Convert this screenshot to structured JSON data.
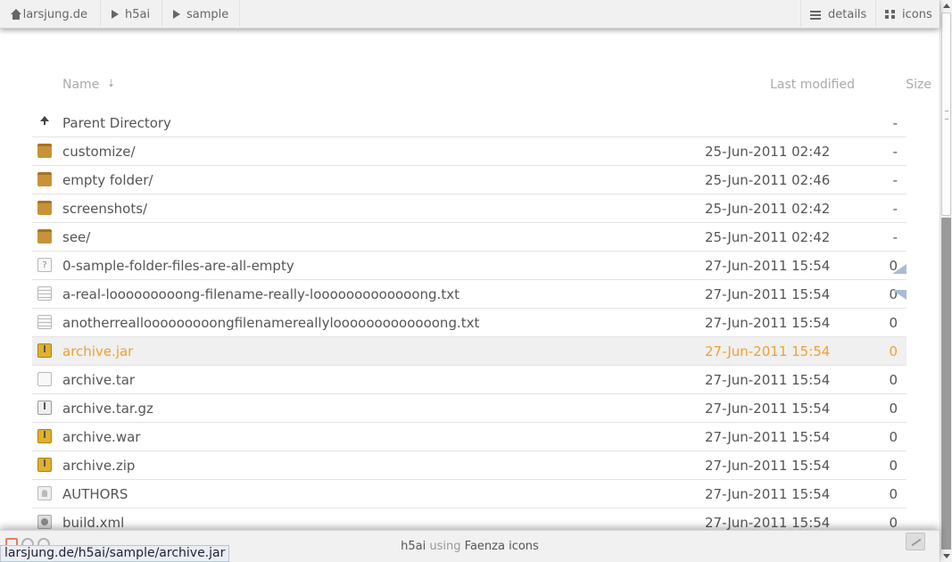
{
  "breadcrumbs": [
    "larsjung.de",
    "h5ai",
    "sample"
  ],
  "views": {
    "details_label": "details",
    "icons_label": "icons"
  },
  "columns": {
    "name": "Name",
    "sort_indicator": "⇣",
    "last_modified": "Last modified",
    "size": "Size"
  },
  "rows": [
    {
      "icon": "up-arrow-icon",
      "name": "Parent Directory",
      "date": "",
      "size": "-"
    },
    {
      "icon": "folder-icon",
      "name": "customize/",
      "date": "25-Jun-2011 02:42",
      "size": "-"
    },
    {
      "icon": "folder-icon",
      "name": "empty folder/",
      "date": "25-Jun-2011 02:46",
      "size": "-"
    },
    {
      "icon": "folder-icon",
      "name": "screenshots/",
      "date": "25-Jun-2011 02:42",
      "size": "-"
    },
    {
      "icon": "folder-icon",
      "name": "see/",
      "date": "25-Jun-2011 02:42",
      "size": "-"
    },
    {
      "icon": "unknown-file-icon",
      "name": "0-sample-folder-files-are-all-empty",
      "date": "27-Jun-2011 15:54",
      "size": "0"
    },
    {
      "icon": "text-file-icon",
      "name": "a-real-looooooooong-filename-really-looooooooooooong.txt",
      "date": "27-Jun-2011 15:54",
      "size": "0"
    },
    {
      "icon": "text-file-icon",
      "name": "anotherreallooooooooongfilenamereallylooooooooooooong.txt",
      "date": "27-Jun-2011 15:54",
      "size": "0"
    },
    {
      "icon": "archive-icon",
      "name": "archive.jar",
      "date": "27-Jun-2011 15:54",
      "size": "0",
      "highlighted": true
    },
    {
      "icon": "blank-file-icon",
      "name": "archive.tar",
      "date": "27-Jun-2011 15:54",
      "size": "0"
    },
    {
      "icon": "archive-grey-icon",
      "name": "archive.tar.gz",
      "date": "27-Jun-2011 15:54",
      "size": "0"
    },
    {
      "icon": "archive-icon",
      "name": "archive.war",
      "date": "27-Jun-2011 15:54",
      "size": "0"
    },
    {
      "icon": "archive-icon",
      "name": "archive.zip",
      "date": "27-Jun-2011 15:54",
      "size": "0"
    },
    {
      "icon": "person-file-icon",
      "name": "AUTHORS",
      "date": "27-Jun-2011 15:54",
      "size": "0"
    },
    {
      "icon": "gear-file-icon",
      "name": "build.xml",
      "date": "27-Jun-2011 15:54",
      "size": "0"
    }
  ],
  "footer": {
    "app": "h5ai",
    "using": "using",
    "icons": "Faenza icons"
  },
  "status_url": "larsjung.de/h5ai/sample/archive.jar",
  "colors": {
    "highlight_text": "#f0a030",
    "folder": "#c8923a"
  }
}
